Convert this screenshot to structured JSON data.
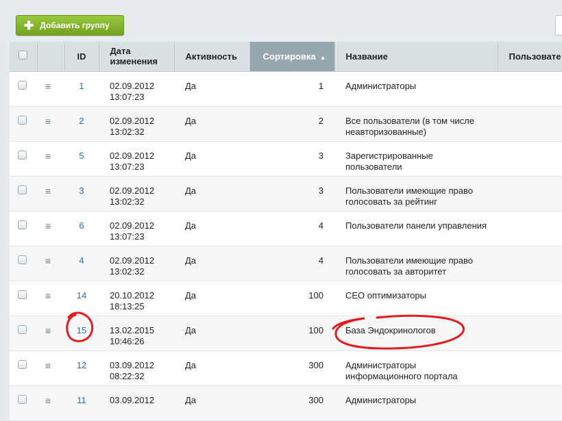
{
  "toolbar": {
    "add_group_label": "Добавить группу"
  },
  "table": {
    "columns": {
      "id": "ID",
      "date": "Дата изменения",
      "active": "Активность",
      "sort": "Сортировка",
      "name": "Название",
      "users": "Пользовате"
    },
    "sort_arrow": "▲",
    "menu_glyph": "≡",
    "rows": [
      {
        "id": "1",
        "date": "02.09.2012",
        "time": "13:07:23",
        "active": "Да",
        "sort": "1",
        "name": "Администраторы"
      },
      {
        "id": "2",
        "date": "02.09.2012",
        "time": "13:02:32",
        "active": "Да",
        "sort": "2",
        "name": "Все пользователи (в том числе неавторизованные)"
      },
      {
        "id": "5",
        "date": "02.09.2012",
        "time": "13:07:23",
        "active": "Да",
        "sort": "3",
        "name": "Зарегистрированные пользователи"
      },
      {
        "id": "3",
        "date": "02.09.2012",
        "time": "13:02:32",
        "active": "Да",
        "sort": "3",
        "name": "Пользователи имеющие право голосовать за рейтинг"
      },
      {
        "id": "6",
        "date": "02.09.2012",
        "time": "13:07:23",
        "active": "Да",
        "sort": "4",
        "name": "Пользователи панели управления"
      },
      {
        "id": "4",
        "date": "02.09.2012",
        "time": "13:02:32",
        "active": "Да",
        "sort": "4",
        "name": "Пользователи имеющие право голосовать за авторитет"
      },
      {
        "id": "14",
        "date": "20.10.2012",
        "time": "18:13:25",
        "active": "Да",
        "sort": "100",
        "name": "СЕО оптимизаторы"
      },
      {
        "id": "15",
        "date": "13.02.2015",
        "time": "10:46:26",
        "active": "Да",
        "sort": "100",
        "name": "База Эндокринологов"
      },
      {
        "id": "12",
        "date": "03.09.2012",
        "time": "08:22:32",
        "active": "Да",
        "sort": "300",
        "name": "Администраторы информационного портала"
      },
      {
        "id": "11",
        "date": "03.09.2012",
        "time": "",
        "active": "Да",
        "sort": "300",
        "name": "Администраторы"
      }
    ]
  },
  "annotation_color": "#e8191b"
}
